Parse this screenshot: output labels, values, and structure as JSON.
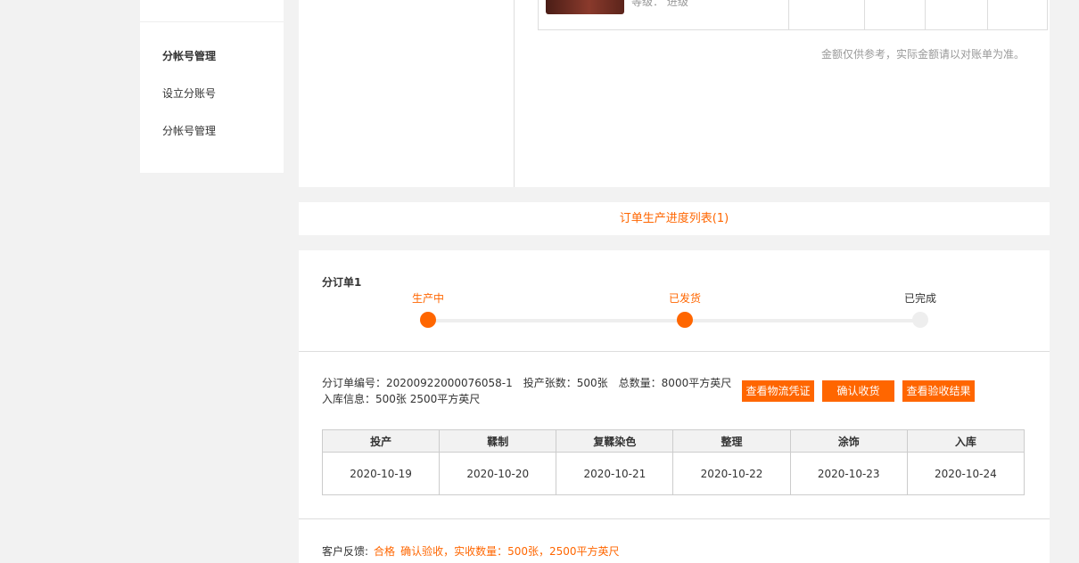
{
  "sidebar": {
    "section_title": "分帐号管理",
    "items": [
      {
        "label": "设立分账号"
      },
      {
        "label": "分帐号管理"
      }
    ]
  },
  "product": {
    "grade_text": "等级：  进级"
  },
  "amount_note": "金额仅供参考，实际金额请以对账单为准。",
  "progress_list_title": "订单生产进度列表(1)",
  "suborder": {
    "title": "分订单1",
    "steps": [
      {
        "label": "生产中",
        "state": "done"
      },
      {
        "label": "已发货",
        "state": "done"
      },
      {
        "label": "已完成",
        "state": "todo"
      }
    ],
    "number_text": "分订单编号：20200922000076058-1",
    "sheets_text": "投产张数：500张",
    "total_text": "总数量：8000平方英尺",
    "stock_text": "入库信息：500张 2500平方英尺",
    "buttons": {
      "logistics": "查看物流凭证",
      "confirm": "确认收货",
      "inspection": "查看验收结果"
    },
    "stages": {
      "headers": [
        "投产",
        "鞣制",
        "复鞣染色",
        "整理",
        "涂饰",
        "入库"
      ],
      "dates": [
        "2020-10-19",
        "2020-10-20",
        "2020-10-21",
        "2020-10-22",
        "2020-10-23",
        "2020-10-24"
      ]
    },
    "feedback": {
      "label": "客户反馈:",
      "status": "合格",
      "detail": "确认验收，实收数量：500张，2500平方英尺"
    }
  },
  "colors": {
    "accent": "#ff6600",
    "background": "#f2f2f2",
    "pending": "#eeeeee"
  }
}
